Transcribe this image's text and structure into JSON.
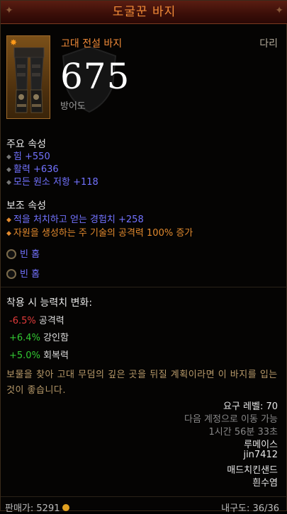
{
  "title": "도굴꾼 바지",
  "item": {
    "name": "고대 전설 바지",
    "slot": "다리",
    "armor": "675",
    "armor_label": "방어도"
  },
  "primary": {
    "heading": "주요 속성",
    "stats": [
      "힘 +550",
      "활력 +636",
      "모든 원소 저항 +118"
    ]
  },
  "secondary": {
    "heading": "보조 속성",
    "stats": [
      "적을 처치하고 얻는 경험치 +258",
      "자원을 생성하는 주 기술의 공격력 100% 증가"
    ]
  },
  "sockets": [
    "빈 홈",
    "빈 홈"
  ],
  "changes": {
    "heading": "착용 시 능력치 변화:",
    "rows": [
      {
        "value": "-6.5%",
        "label": "공격력",
        "sign": "neg"
      },
      {
        "value": "+6.4%",
        "label": "강인함",
        "sign": "pos"
      },
      {
        "value": "+5.0%",
        "label": "회복력",
        "sign": "pos"
      }
    ]
  },
  "flavor": "보물을 찾아 고대 무덤의 깊은 곳을 뒤질 계획이라면 이 바지를 입는 것이 좋습니다.",
  "requirements": {
    "level": "요구 레벨: 70",
    "tradable": "다음 계정으로 이동 가능",
    "time": "1시간 56분 33초",
    "names": [
      "루메이스",
      "jin7412",
      "매드치킨샌드",
      "흰수염"
    ]
  },
  "footer": {
    "sell_label": "판매가:",
    "sell_value": "5291",
    "durability_label": "내구도:",
    "durability_value": "36/36"
  },
  "colors": {
    "title": "#f28b38",
    "primary_stat": "#7272ff",
    "secondary_stat": "#e28a2e",
    "negative": "#e23b3b",
    "positive": "#32c832",
    "flavor": "#b89a6a"
  }
}
